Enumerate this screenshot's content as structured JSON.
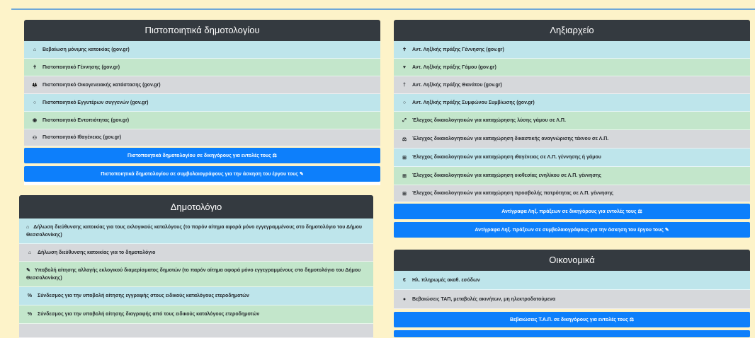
{
  "left_panel": {
    "title": "Πιστοποιητικά δημοτολογίου",
    "items": [
      {
        "icon": "home-icon",
        "glyph": "⌂",
        "label": "Βεβαίωση μόνιμης κατοικίας (gov.gr)"
      },
      {
        "icon": "child-icon",
        "glyph": "✝",
        "label": "Πιστοποιητικό Γέννησης (gov.gr)"
      },
      {
        "icon": "family-icon",
        "glyph": "👪",
        "label": "Πιστοποιητικό Οικογενειακής κατάστασης (gov.gr)"
      },
      {
        "icon": "circle-icon",
        "glyph": "○",
        "label": "Πιστοποιητικό Εγγυτέρων συγγενών (gov.gr)"
      },
      {
        "icon": "fingerprint-icon",
        "glyph": "◉",
        "label": "Πιστοποιητικό Εντοπιότητας (gov.gr)"
      },
      {
        "icon": "people-icon",
        "glyph": "⚇",
        "label": "Πιστοποιητικό Ιθαγένειας (gov.gr)"
      }
    ],
    "buttons": [
      "Πιστοποιητικά δημοτολογίου σε δικηγόρους για εντολές τους ⚖",
      "Πιστοποιητικά δημοτολογίου σε συμβολαιογράφους για την άσκηση του έργου τους ✎"
    ]
  },
  "dimotologio_panel": {
    "title": "Δημοτολόγιο",
    "items": [
      {
        "icon": "home-icon",
        "glyph": "⌂",
        "label": "Δήλωση διεύθυνσης κατοικίας για τους εκλογικούς καταλόγους (το παρόν αίτημα αφορά μόνο εγγεγραμμένους στο δημοτολόγιο του Δήμου Θεσσαλονίκης)"
      },
      {
        "icon": "home-icon",
        "glyph": "⌂",
        "label": "Δήλωση διεύθυνσης κατοικίας για το δημοτολόγιο"
      },
      {
        "icon": "edit-icon",
        "glyph": "✎",
        "label": "Υποβολή αίτησης αλλαγής εκλογικού διαμερίσματος δημοτών (το παρόν αίτημα αφορά μόνο εγγεγραμμένους στο δημοτολόγιο του Δήμου Θεσσαλονίκης)"
      },
      {
        "icon": "link-icon",
        "glyph": "%",
        "label": "Σύνδεσμος για την υποβολή αίτησης εγγραφής στους ειδικούς καταλόγους ετεροδημοτών"
      },
      {
        "icon": "link-icon",
        "glyph": "%",
        "label": "Σύνδεσμος για την υποβολή αίτησης διαγραφής από τους ειδικούς καταλόγους ετεροδημοτών"
      }
    ]
  },
  "right_panel": {
    "title": "Ληξιαρχείο",
    "items": [
      {
        "icon": "child-icon",
        "glyph": "✝",
        "label": "Αντ. Ληξ/κής πράξης Γέννησης (gov.gr)"
      },
      {
        "icon": "heart-icon",
        "glyph": "♥",
        "label": "Αντ. Ληξ/κής πράξης Γάμου (gov.gr)"
      },
      {
        "icon": "cross-icon",
        "glyph": "†",
        "label": "Αντ. Ληξ/κής πράξης Θανάτου (gov.gr)"
      },
      {
        "icon": "circle-icon",
        "glyph": "○",
        "label": "Αντ. Ληξ/κής πράξης Συμφώνου Συμβίωσης (gov.gr)"
      },
      {
        "icon": "expand-icon",
        "glyph": "⤢",
        "label": "Έλεγχος δικαιολογητικών για καταχώρησης λύσης γάμου σε Λ.Π."
      },
      {
        "icon": "scale-icon",
        "glyph": "⚖",
        "label": "Έλεγχος δικαιολογητικών για καταχώρηση δικαστικής αναγνώρισης τέκνου σε Λ.Π."
      },
      {
        "icon": "plus-square-icon",
        "glyph": "⊞",
        "label": "Έλεγχος δικαιολογητικών για καταχώρηση ιθαγένειας σε Λ.Π. γέννησης ή γάμου"
      },
      {
        "icon": "plus-square-icon",
        "glyph": "⊞",
        "label": "Έλεγχος δικαιολογητικών για καταχώρηση υιοθεσίας ενηλίκου σε Λ.Π. γέννησης"
      },
      {
        "icon": "plus-square-icon",
        "glyph": "⊞",
        "label": "Έλεγχος δικαιολογητικών για καταχώρηση προσβολής πατρότητας σε Λ.Π. γέννησης"
      }
    ],
    "buttons": [
      "Αντίγραφα Ληξ. πράξεων σε δικηγόρους για εντολές τους ⚖",
      "Αντίγραφα Ληξ. πράξεων σε συμβολαιογράφους για την άσκηση του έργου τους ✎"
    ]
  },
  "oikonomika_panel": {
    "title": "Οικονομικά",
    "items": [
      {
        "icon": "euro-icon",
        "glyph": "€",
        "label": "Ηλ. πληρωμές ακαθ. εσόδων"
      },
      {
        "icon": "dot-icon",
        "glyph": "●",
        "label": "Βεβαιώσεις ΤΑΠ, μεταβολές ακινήτων, μη ηλεκτροδοτούμενα"
      }
    ],
    "buttons": [
      "Βεβαιώσεις Τ.Α.Π. σε δικηγόρους για εντολές τους ⚖"
    ]
  },
  "colors": {
    "info": "#bee5eb",
    "success": "#c3e6cb",
    "secondary": "#d6d8db",
    "primary": "#0d7ffb",
    "dark": "#343a40"
  }
}
